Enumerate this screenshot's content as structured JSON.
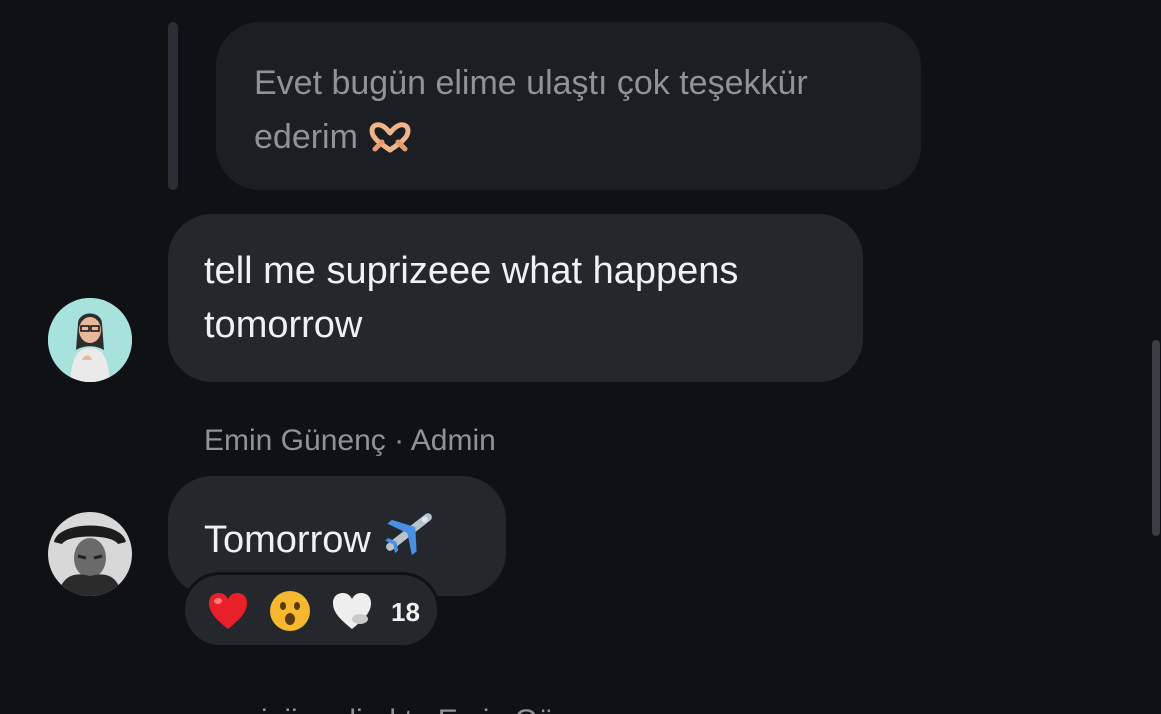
{
  "messages": {
    "quoted": {
      "text": "Evet bugün elime ulaştı çok teşekkür ederim",
      "emoji_icon": "heart-hands-icon"
    },
    "first": {
      "text": "tell me suprizeee what happens tomorrow"
    },
    "second": {
      "sender": "Emin Günenç · Admin",
      "text": "Tomorrow",
      "emoji_icon": "airplane-icon"
    }
  },
  "reactions": {
    "icons": [
      "red-heart-icon",
      "surprised-face-icon",
      "white-heart-icon"
    ],
    "count": "18"
  },
  "cutoff_line": "…cinii replied to Emin Günenç",
  "colors": {
    "background": "#0f1115",
    "bubble": "#24272c",
    "quoted_bubble": "#1b1e23",
    "text": "#f0f1f3",
    "muted_text": "#8f9399"
  }
}
